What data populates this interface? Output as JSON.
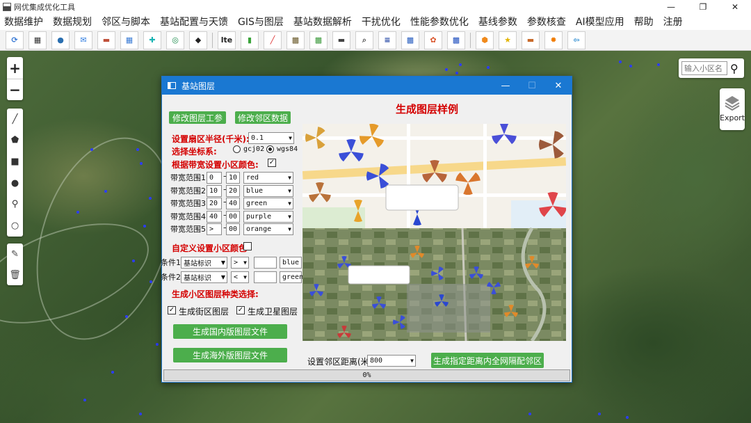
{
  "app": {
    "title": "网优集成优化工具",
    "window_controls": [
      "—",
      "❐",
      "✕"
    ]
  },
  "menu": [
    "数据维护",
    "数据规划",
    "邻区与脚本",
    "基站配置与天馈",
    "GIS与图层",
    "基站数据解析",
    "干扰优化",
    "性能参数优化",
    "基线参数",
    "参数核查",
    "AI模型应用",
    "帮助",
    "注册"
  ],
  "toolbar": {
    "buttons": [
      {
        "name": "globe-sync-icon",
        "glyph": "⟳",
        "color": "#3a7bd5"
      },
      {
        "name": "table-icon",
        "glyph": "▦",
        "color": "#333"
      },
      {
        "name": "earth-icon",
        "glyph": "●",
        "color": "#2a6fb0"
      },
      {
        "name": "mail-icon",
        "glyph": "✉",
        "color": "#2d7be0"
      },
      {
        "name": "landscape-icon",
        "glyph": "▬",
        "color": "#c0503a"
      },
      {
        "name": "calculator-icon",
        "glyph": "▦",
        "color": "#3a7bd5"
      },
      {
        "name": "medical-cross-icon",
        "glyph": "✚",
        "color": "#19b3b3"
      },
      {
        "name": "china-mobile-icon",
        "glyph": "◎",
        "color": "#1a8a4a"
      },
      {
        "name": "map-region-icon",
        "glyph": "◆",
        "color": "#222"
      },
      {
        "name": "lte-icon",
        "glyph": "lte",
        "color": "#222"
      },
      {
        "name": "bar-chart-icon",
        "glyph": "▮",
        "color": "#3aa33a"
      },
      {
        "name": "line-chart-icon",
        "glyph": "╱",
        "color": "#d33"
      },
      {
        "name": "map-picture-icon",
        "glyph": "▩",
        "color": "#6a5a2a"
      },
      {
        "name": "map-green-icon",
        "glyph": "▩",
        "color": "#3c9a3c"
      },
      {
        "name": "rack-icon",
        "glyph": "▬",
        "color": "#444"
      },
      {
        "name": "magnifier-doc-icon",
        "glyph": "⌕",
        "color": "#555"
      },
      {
        "name": "document-icon",
        "glyph": "≡",
        "color": "#1a3fa0"
      },
      {
        "name": "blue-image-icon",
        "glyph": "▩",
        "color": "#2a5fc0"
      },
      {
        "name": "puzzle-icon",
        "glyph": "✿",
        "color": "#d9542a"
      },
      {
        "name": "signal-map-icon",
        "glyph": "▩",
        "color": "#1f4fbf"
      },
      {
        "name": "hexagon-icon",
        "glyph": "⬢",
        "color": "#f08a1c"
      },
      {
        "name": "star-icon",
        "glyph": "★",
        "color": "#e2b400"
      },
      {
        "name": "sunset-icon",
        "glyph": "▬",
        "color": "#c86a2a"
      },
      {
        "name": "fire-icon",
        "glyph": "✹",
        "color": "#f07a00"
      },
      {
        "name": "exit-door-icon",
        "glyph": "⇦",
        "color": "#2a8ad0"
      }
    ]
  },
  "map": {
    "zoom_in": "+",
    "zoom_out": "−",
    "draw_tools": [
      "╱",
      "⬟",
      "■",
      "●",
      "⚲",
      "○"
    ],
    "edit_tools": [
      "✎",
      "🗑"
    ],
    "search_placeholder": "输入小区名",
    "export_label": "Export"
  },
  "dialog": {
    "title": "基站图层",
    "btn_modify_params": "修改图层工参",
    "btn_modify_neighbors": "修改邻区数据",
    "radius_label": "设置扇区半径(千米):",
    "radius_value": "0.1",
    "coord_label": "选择坐标系:",
    "coord_options": [
      "gcj02",
      "wgs84"
    ],
    "coord_selected": "wgs84",
    "bandwidth_color_label": "根据带宽设置小区颜色:",
    "bandwidth_color_checked": true,
    "bandwidth_ranges": [
      {
        "label": "带宽范围1:",
        "from": "0",
        "to": "10",
        "color": "red"
      },
      {
        "label": "带宽范围2:",
        "from": "10",
        "to": "20",
        "color": "blue"
      },
      {
        "label": "带宽范围3:",
        "from": "20",
        "to": "40",
        "color": "green"
      },
      {
        "label": "带宽范围4:",
        "from": "40",
        "to": "00",
        "color": "purple"
      },
      {
        "label": "带宽范围5:",
        "from": ">",
        "to": "00",
        "color": "orange"
      }
    ],
    "custom_color_label": "自定义设置小区颜色",
    "custom_color_checked": false,
    "conditions": [
      {
        "label": "条件1",
        "field": "基站标识",
        "op": ">",
        "value": "",
        "color": "blue"
      },
      {
        "label": "条件2",
        "field": "基站标识",
        "op": "<",
        "value": "",
        "color": "green"
      }
    ],
    "layer_type_label": "生成小区图层种类选择:",
    "street_layer_label": "生成街区图层",
    "street_layer_checked": true,
    "satellite_layer_label": "生成卫星图层",
    "satellite_layer_checked": true,
    "btn_domestic": "生成国内版图层文件",
    "btn_overseas": "生成海外版图层文件",
    "preview_title": "生成图层样例",
    "neighbor_distance_label": "设置邻区距离(米)",
    "neighbor_distance_value": "800",
    "btn_neighbors": "生成指定距离内全网隔配邻区",
    "progress_text": "0%",
    "progress": 0
  }
}
